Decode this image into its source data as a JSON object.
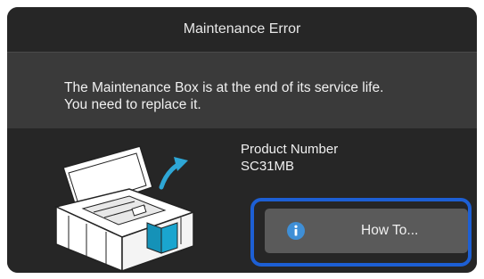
{
  "dialog": {
    "title": "Maintenance Error",
    "message_line1": "The Maintenance Box is at the end of its service life.",
    "message_line2": "You need to replace it."
  },
  "product": {
    "label": "Product Number",
    "number": "SC31MB"
  },
  "buttons": {
    "how_to_label": "How To...",
    "how_to_icon": "info-icon"
  },
  "illustration": {
    "icon": "printer-maintenance-box-illustration"
  },
  "colors": {
    "accent": "#1d5fd4",
    "info_icon": "#3f8fd6",
    "highlight_box": "#1aa5cf"
  }
}
